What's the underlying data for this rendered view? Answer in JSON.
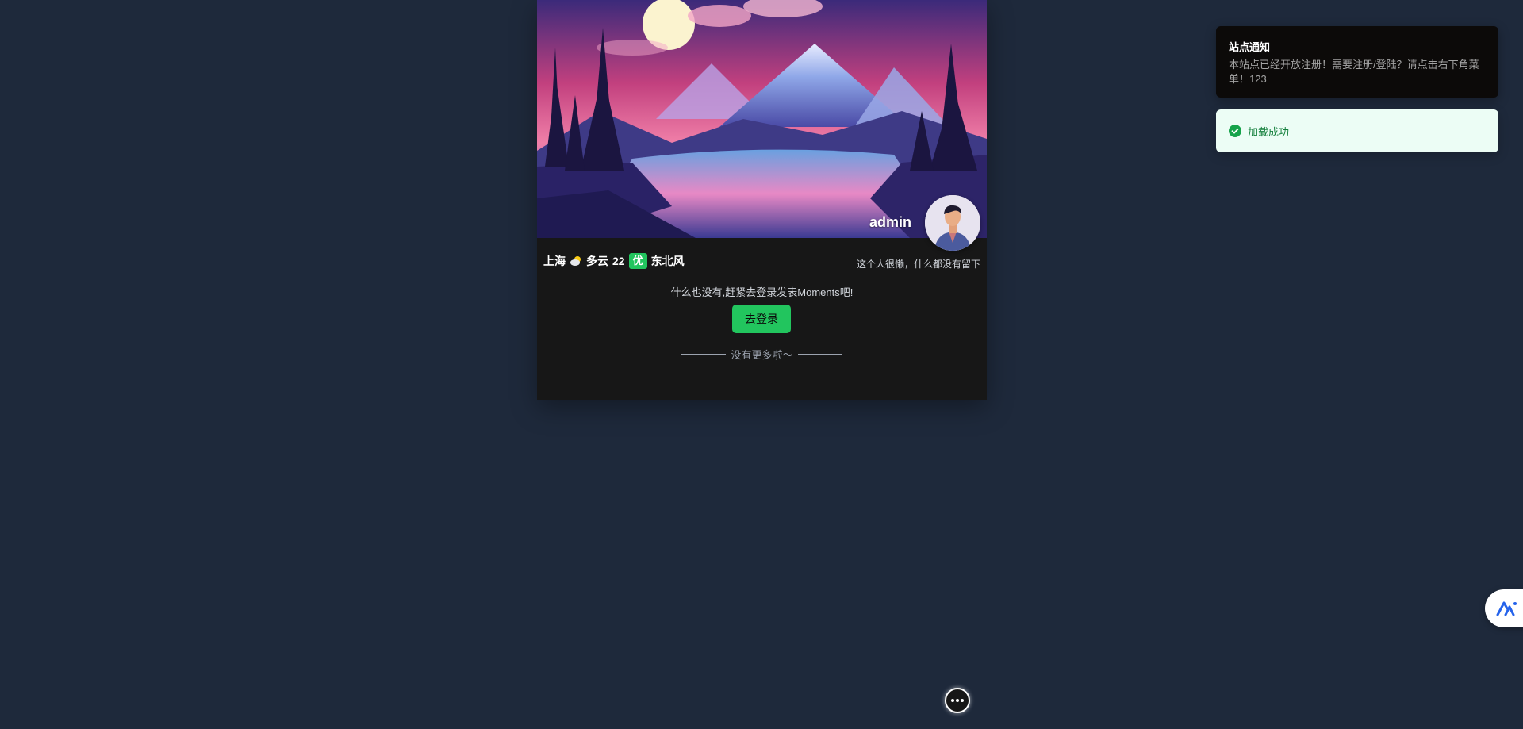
{
  "profile": {
    "username": "admin",
    "signature": "这个人很懒，什么都没有留下"
  },
  "weather": {
    "city": "上海",
    "icon": "partly-cloudy-icon",
    "condition": "多云",
    "temperature": "22",
    "aqi": "优",
    "wind": "东北风"
  },
  "feed": {
    "empty_message": "什么也没有,赶紧去登录发表Moments吧!",
    "login_label": "去登录",
    "no_more": "没有更多啦～"
  },
  "notice": {
    "title": "站点通知",
    "body": "本站点已经开放注册！需要注册/登陆？请点击右下角菜单！123"
  },
  "toast": {
    "message": "加载成功",
    "color": "#15803d"
  },
  "colors": {
    "page_bg": "#1e293b",
    "card_bg": "#171717",
    "accent": "#22c55e"
  }
}
